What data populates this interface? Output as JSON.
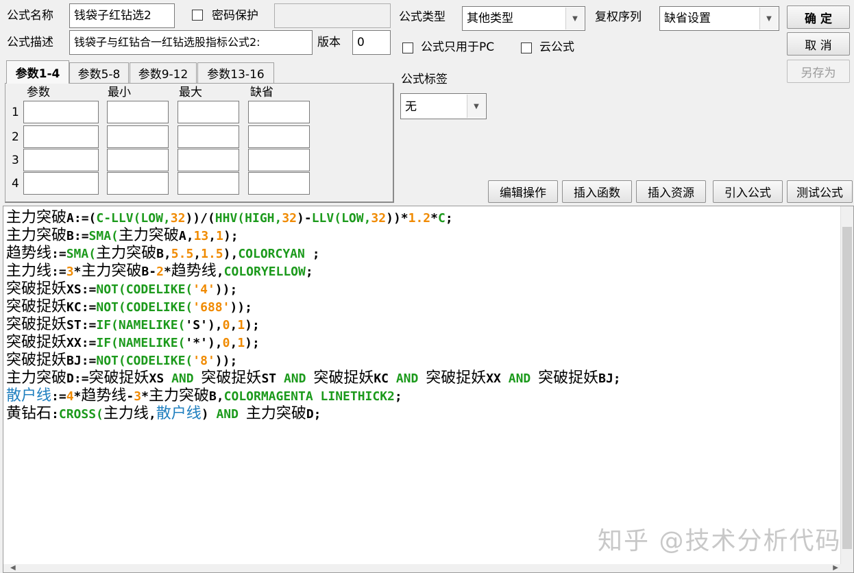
{
  "form": {
    "name_label": "公式名称",
    "name_value": "钱袋子红钻选2",
    "password_label": "密码保护",
    "password_value": "",
    "desc_label": "公式描述",
    "desc_value": "钱袋子与红钻合一红钻选股指标公式2:",
    "version_label": "版本",
    "version_value": "0",
    "type_label": "公式类型",
    "type_value": "其他类型",
    "rights_label": "复权序列",
    "rights_value": "缺省设置",
    "pc_only_label": "公式只用于PC",
    "cloud_label": "云公式",
    "tag_label": "公式标签",
    "tag_value": "无"
  },
  "buttons": {
    "ok": "确  定",
    "cancel": "取  消",
    "save_as": "另存为",
    "edit_ops": "编辑操作",
    "insert_func": "插入函数",
    "insert_res": "插入资源",
    "import_formula": "引入公式",
    "test_formula": "测试公式"
  },
  "params": {
    "tabs": [
      "参数1-4",
      "参数5-8",
      "参数9-12",
      "参数13-16"
    ],
    "headers": [
      "参数",
      "最小",
      "最大",
      "缺省"
    ],
    "rows": [
      "1",
      "2",
      "3",
      "4"
    ]
  },
  "code_lines": [
    [
      [
        "主力突破",
        "k",
        "cn"
      ],
      [
        "A:=(",
        "k",
        "lat"
      ],
      [
        "C-LLV(LOW,",
        "g",
        "lat"
      ],
      [
        "32",
        "o",
        "lat"
      ],
      [
        "))/(",
        "k",
        "lat"
      ],
      [
        "HHV(HIGH,",
        "g",
        "lat"
      ],
      [
        "32",
        "o",
        "lat"
      ],
      [
        ")-",
        "k",
        "lat"
      ],
      [
        "LLV(LOW,",
        "g",
        "lat"
      ],
      [
        "32",
        "o",
        "lat"
      ],
      [
        "))*",
        "k",
        "lat"
      ],
      [
        "1.2",
        "o",
        "lat"
      ],
      [
        "*",
        "k",
        "lat"
      ],
      [
        "C",
        "g",
        "lat"
      ],
      [
        ";",
        "k",
        "lat"
      ]
    ],
    [
      [
        "主力突破",
        "k",
        "cn"
      ],
      [
        "B:=",
        "k",
        "lat"
      ],
      [
        "SMA(",
        "g",
        "lat"
      ],
      [
        "主力突破",
        "k",
        "cn"
      ],
      [
        "A,",
        "k",
        "lat"
      ],
      [
        "13",
        "o",
        "lat"
      ],
      [
        ",",
        "k",
        "lat"
      ],
      [
        "1",
        "o",
        "lat"
      ],
      [
        ");",
        "k",
        "lat"
      ]
    ],
    [
      [
        "趋势线",
        "k",
        "cn"
      ],
      [
        ":=",
        "k",
        "lat"
      ],
      [
        "SMA(",
        "g",
        "lat"
      ],
      [
        "主力突破",
        "k",
        "cn"
      ],
      [
        "B,",
        "k",
        "lat"
      ],
      [
        "5.5",
        "o",
        "lat"
      ],
      [
        ",",
        "k",
        "lat"
      ],
      [
        "1.5",
        "o",
        "lat"
      ],
      [
        "),",
        "k",
        "lat"
      ],
      [
        "COLORCYAN",
        "g",
        "lat"
      ],
      [
        " ;",
        "k",
        "lat"
      ]
    ],
    [
      [
        "主力线",
        "k",
        "cn"
      ],
      [
        ":=",
        "k",
        "lat"
      ],
      [
        "3",
        "o",
        "lat"
      ],
      [
        "*",
        "k",
        "lat"
      ],
      [
        "主力突破",
        "k",
        "cn"
      ],
      [
        "B-",
        "k",
        "lat"
      ],
      [
        "2",
        "o",
        "lat"
      ],
      [
        "*",
        "k",
        "lat"
      ],
      [
        "趋势线",
        "k",
        "cn"
      ],
      [
        ",",
        "k",
        "lat"
      ],
      [
        "COLORYELLOW",
        "g",
        "lat"
      ],
      [
        ";",
        "k",
        "lat"
      ]
    ],
    [
      [
        "突破捉妖",
        "k",
        "cn"
      ],
      [
        "XS:=",
        "k",
        "lat"
      ],
      [
        "NOT(CODELIKE(",
        "g",
        "lat"
      ],
      [
        "'4'",
        "o",
        "lat"
      ],
      [
        "));",
        "k",
        "lat"
      ]
    ],
    [
      [
        "突破捉妖",
        "k",
        "cn"
      ],
      [
        "KC:=",
        "k",
        "lat"
      ],
      [
        "NOT(CODELIKE(",
        "g",
        "lat"
      ],
      [
        "'688'",
        "o",
        "lat"
      ],
      [
        "));",
        "k",
        "lat"
      ]
    ],
    [
      [
        "突破捉妖",
        "k",
        "cn"
      ],
      [
        "ST:=",
        "k",
        "lat"
      ],
      [
        "IF(NAMELIKE(",
        "g",
        "lat"
      ],
      [
        "'S'",
        "k",
        "lat"
      ],
      [
        "),",
        "k",
        "lat"
      ],
      [
        "0",
        "o",
        "lat"
      ],
      [
        ",",
        "k",
        "lat"
      ],
      [
        "1",
        "o",
        "lat"
      ],
      [
        ");",
        "k",
        "lat"
      ]
    ],
    [
      [
        "突破捉妖",
        "k",
        "cn"
      ],
      [
        "XX:=",
        "k",
        "lat"
      ],
      [
        "IF(NAMELIKE(",
        "g",
        "lat"
      ],
      [
        "'*'",
        "k",
        "lat"
      ],
      [
        "),",
        "k",
        "lat"
      ],
      [
        "0",
        "o",
        "lat"
      ],
      [
        ",",
        "k",
        "lat"
      ],
      [
        "1",
        "o",
        "lat"
      ],
      [
        ");",
        "k",
        "lat"
      ]
    ],
    [
      [
        "突破捉妖",
        "k",
        "cn"
      ],
      [
        "BJ:=",
        "k",
        "lat"
      ],
      [
        "NOT(CODELIKE(",
        "g",
        "lat"
      ],
      [
        "'8'",
        "o",
        "lat"
      ],
      [
        "));",
        "k",
        "lat"
      ]
    ],
    [
      [
        "主力突破",
        "k",
        "cn"
      ],
      [
        "D:=",
        "k",
        "lat"
      ],
      [
        "突破捉妖",
        "k",
        "cn"
      ],
      [
        "XS ",
        "k",
        "lat"
      ],
      [
        "AND ",
        "g",
        "lat"
      ],
      [
        "突破捉妖",
        "k",
        "cn"
      ],
      [
        "ST ",
        "k",
        "lat"
      ],
      [
        "AND ",
        "g",
        "lat"
      ],
      [
        "突破捉妖",
        "k",
        "cn"
      ],
      [
        "KC ",
        "k",
        "lat"
      ],
      [
        "AND ",
        "g",
        "lat"
      ],
      [
        "突破捉妖",
        "k",
        "cn"
      ],
      [
        "XX ",
        "k",
        "lat"
      ],
      [
        "AND ",
        "g",
        "lat"
      ],
      [
        "突破捉妖",
        "k",
        "cn"
      ],
      [
        "BJ;",
        "k",
        "lat"
      ]
    ],
    [
      [
        "散户线",
        "b",
        "cn"
      ],
      [
        ":=",
        "k",
        "lat"
      ],
      [
        "4",
        "o",
        "lat"
      ],
      [
        "*",
        "k",
        "lat"
      ],
      [
        "趋势线",
        "k",
        "cn"
      ],
      [
        "-",
        "k",
        "lat"
      ],
      [
        "3",
        "o",
        "lat"
      ],
      [
        "*",
        "k",
        "lat"
      ],
      [
        "主力突破",
        "k",
        "cn"
      ],
      [
        "B,",
        "k",
        "lat"
      ],
      [
        "COLORMAGENTA LINETHICK2",
        "g",
        "lat"
      ],
      [
        ";",
        "k",
        "lat"
      ]
    ],
    [
      [
        "黄钻石",
        "k",
        "cn"
      ],
      [
        ":",
        "k",
        "lat"
      ],
      [
        "CROSS(",
        "g",
        "lat"
      ],
      [
        "主力线",
        "k",
        "cn"
      ],
      [
        ",",
        "k",
        "lat"
      ],
      [
        "散户线",
        "b",
        "cn"
      ],
      [
        ") ",
        "k",
        "lat"
      ],
      [
        "AND ",
        "g",
        "lat"
      ],
      [
        "主力突破",
        "k",
        "cn"
      ],
      [
        "D;",
        "k",
        "lat"
      ]
    ]
  ],
  "colors": {
    "code_black": "#000000",
    "code_green": "#1c9a1c",
    "code_orange": "#f08a00",
    "code_blue": "#1f7fbf"
  },
  "watermark": "知乎 @技术分析代码"
}
